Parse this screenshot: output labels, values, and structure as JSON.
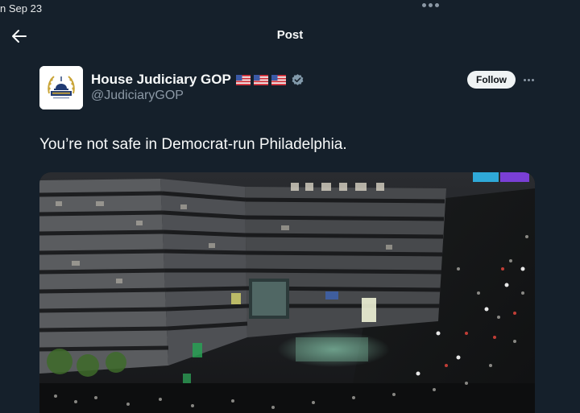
{
  "status_bar": {
    "date_fragment": "n Sep 23"
  },
  "header": {
    "title": "Post"
  },
  "author": {
    "name": "House Judiciary GOP",
    "handle": "@JudiciaryGOP",
    "flag_count": 3,
    "verified": true
  },
  "actions": {
    "follow_label": "Follow"
  },
  "tweet": {
    "text": "You’re not safe in Democrat-run Philadelphia."
  },
  "icons": {
    "back": "arrow-left-icon",
    "more": "more-horizontal-icon",
    "verified": "verified-badge-icon",
    "flag": "us-flag-icon"
  },
  "colors": {
    "background": "#15202b",
    "text_primary": "#f7f9f9",
    "text_secondary": "#8b98a5",
    "follow_bg": "#eff3f4"
  }
}
